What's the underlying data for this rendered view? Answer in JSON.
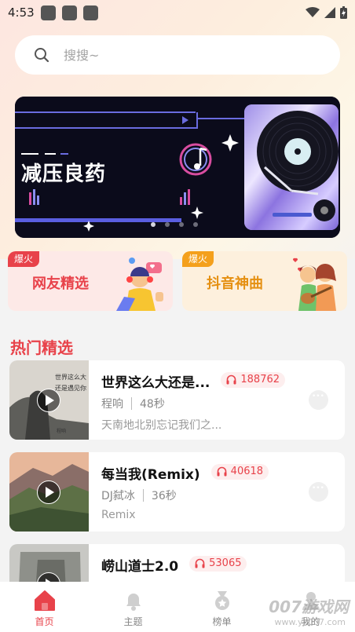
{
  "status_bar": {
    "time": "4:53"
  },
  "search": {
    "placeholder": "搜搜~"
  },
  "banner": {
    "title": "减压良药",
    "dot_count": 4,
    "active_dot": 0
  },
  "cards": [
    {
      "badge": "爆火",
      "label": "网友精选"
    },
    {
      "badge": "爆火",
      "label": "抖音神曲"
    }
  ],
  "section": {
    "title": "热门精选"
  },
  "songs": [
    {
      "title": "世界这么大还是...",
      "plays": "188762",
      "artist": "程响",
      "duration": "48秒",
      "desc": "天南地北别忘记我们之..."
    },
    {
      "title": "每当我(Remix)",
      "plays": "40618",
      "artist": "DJ弑冰",
      "duration": "36秒",
      "desc": "Remix"
    },
    {
      "title": "崂山道士2.0",
      "plays": "53065",
      "artist": "",
      "duration": "",
      "desc": ""
    }
  ],
  "tabs": [
    {
      "label": "首页",
      "icon": "home-icon",
      "active": true
    },
    {
      "label": "主题",
      "icon": "bell-icon",
      "active": false
    },
    {
      "label": "榜单",
      "icon": "medal-icon",
      "active": false
    },
    {
      "label": "我的",
      "icon": "user-icon",
      "active": false
    }
  ],
  "watermark": {
    "brand": "007游戏网",
    "url": "www.yx007.com"
  },
  "colors": {
    "accent": "#e8424a",
    "orange": "#f4a01c"
  }
}
